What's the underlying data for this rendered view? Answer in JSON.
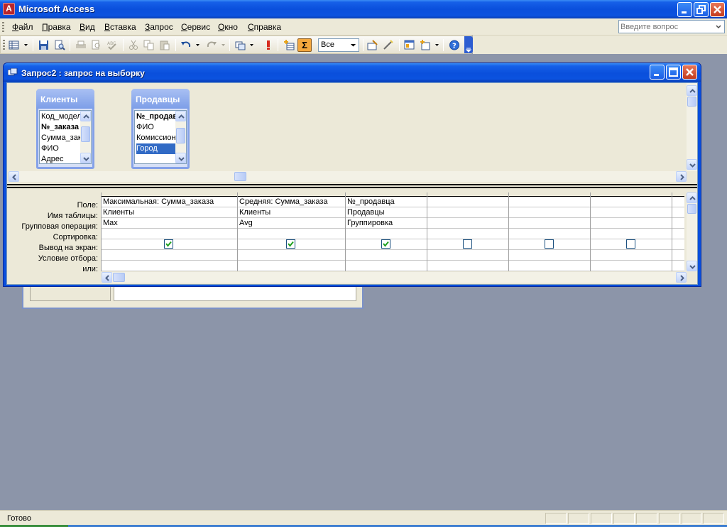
{
  "app": {
    "title": "Microsoft Access",
    "icon": "access-key-icon"
  },
  "menu": {
    "items": [
      "Файл",
      "Правка",
      "Вид",
      "Вставка",
      "Запрос",
      "Сервис",
      "Окно",
      "Справка"
    ],
    "help_placeholder": "Введите вопрос"
  },
  "toolbar": {
    "top_values": "Все",
    "sigma": "Σ"
  },
  "query_window": {
    "title": "Запрос2 : запрос на выборку",
    "tables": [
      {
        "name": "Клиенты",
        "fields": [
          "Код_модели",
          "№_заказа",
          "Сумма_заказа",
          "ФИО",
          "Адрес"
        ],
        "key_index": 1,
        "selected_index": -1
      },
      {
        "name": "Продавцы",
        "fields": [
          "№_продавца",
          "ФИО",
          "Комиссионные",
          "Город"
        ],
        "key_index": 0,
        "selected_index": 3
      }
    ],
    "row_labels": [
      "Поле:",
      "Имя таблицы:",
      "Групповая операция:",
      "Сортировка:",
      "Вывод на экран:",
      "Условие отбора:",
      "или:"
    ],
    "columns": [
      {
        "field": "Максимальная: Сумма_заказа",
        "table": "Клиенты",
        "total": "Max",
        "sort": "",
        "show": true
      },
      {
        "field": "Средняя: Сумма_заказа",
        "table": "Клиенты",
        "total": "Avg",
        "sort": "",
        "show": true
      },
      {
        "field": "№_продавца",
        "table": "Продавцы",
        "total": "Группировка",
        "sort": "",
        "show": true
      },
      {
        "field": "",
        "table": "",
        "total": "",
        "sort": "",
        "show": false
      },
      {
        "field": "",
        "table": "",
        "total": "",
        "sort": "",
        "show": false
      },
      {
        "field": "",
        "table": "",
        "total": "",
        "sort": "",
        "show": false
      }
    ]
  },
  "status": {
    "text": "Готово"
  },
  "colors": {
    "titlebar": "#0a4fdc",
    "face": "#ece9d8",
    "desktop": "#8c95a9",
    "selection": "#316ac5",
    "sigma_active": "#f3a73d"
  }
}
